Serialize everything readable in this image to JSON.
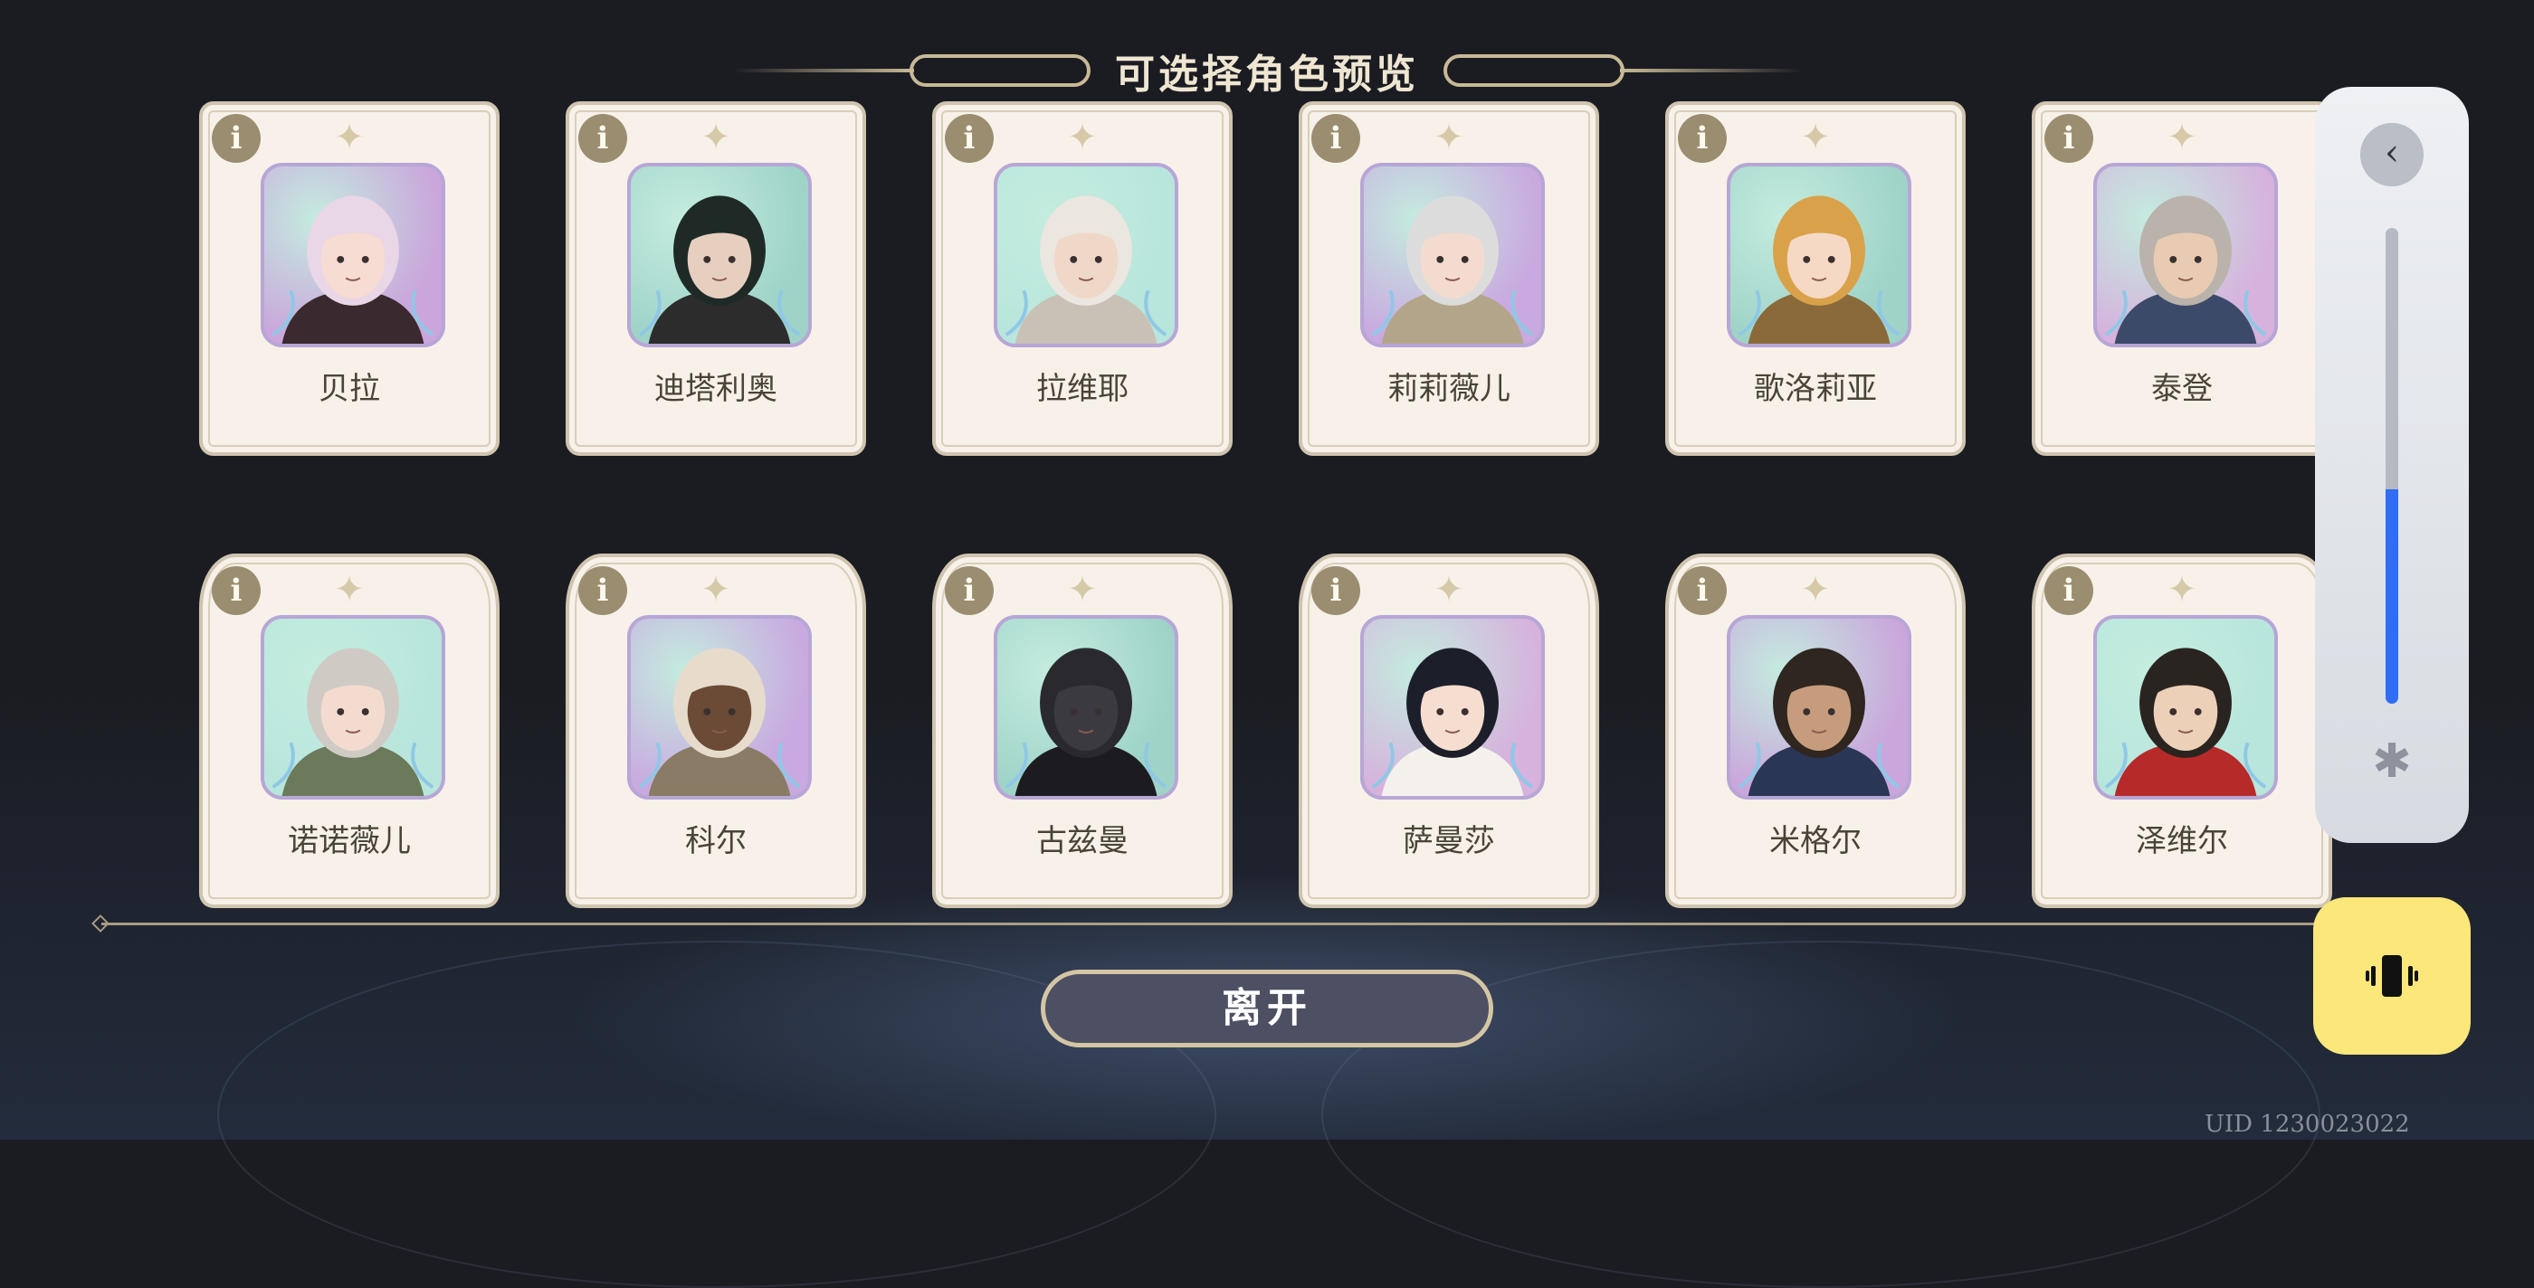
{
  "title": "可选择角色预览",
  "characters": [
    {
      "name": "贝拉",
      "info": "i",
      "hair": "#e9d6e6",
      "skin": "#f6dcd2",
      "accent": "#3a2a2f",
      "bg": "#caa6dc",
      "frame": "square"
    },
    {
      "name": "迪塔利奥",
      "info": "i",
      "hair": "#1f2a26",
      "skin": "#e6cfbf",
      "accent": "#2c2c2c",
      "bg": "#9fd3c8",
      "frame": "square"
    },
    {
      "name": "拉维耶",
      "info": "i",
      "hair": "#ece6e0",
      "skin": "#f0d8c8",
      "accent": "#c9c0b6",
      "bg": "#b8e6dc",
      "frame": "square"
    },
    {
      "name": "莉莉薇儿",
      "info": "i",
      "hair": "#dcdcdc",
      "skin": "#f3dccf",
      "accent": "#b3a58a",
      "bg": "#c9a9e0",
      "frame": "square"
    },
    {
      "name": "歌洛莉亚",
      "info": "i",
      "hair": "#d9a24a",
      "skin": "#f5d9c4",
      "accent": "#8a6a3a",
      "bg": "#9fd3c8",
      "frame": "square"
    },
    {
      "name": "泰登",
      "info": "i",
      "hair": "#b9b3ab",
      "skin": "#e8cbb2",
      "accent": "#3c4a6a",
      "bg": "#d6b2dd",
      "frame": "square"
    },
    {
      "name": "诺诺薇儿",
      "info": "i",
      "hair": "#cfcbc4",
      "skin": "#f3dccf",
      "accent": "#6b7a5a",
      "bg": "#b8e6dc",
      "frame": "arched"
    },
    {
      "name": "科尔",
      "info": "i",
      "hair": "#e7dccb",
      "skin": "#6b4a36",
      "accent": "#8a7b65",
      "bg": "#c9a9e0",
      "frame": "arched"
    },
    {
      "name": "古兹曼",
      "info": "i",
      "hair": "#2a2a2e",
      "skin": "#3a3a40",
      "accent": "#1c1c20",
      "bg": "#9fd3c8",
      "frame": "arched"
    },
    {
      "name": "萨曼莎",
      "info": "i",
      "hair": "#1c1f2a",
      "skin": "#f5ddd0",
      "accent": "#f4f1ec",
      "bg": "#d6b2dd",
      "frame": "arched"
    },
    {
      "name": "米格尔",
      "info": "i",
      "hair": "#2e261f",
      "skin": "#c69c7c",
      "accent": "#2a3656",
      "bg": "#caa6dc",
      "frame": "arched"
    },
    {
      "name": "泽维尔",
      "info": "i",
      "hair": "#2a2420",
      "skin": "#edd0b8",
      "accent": "#b62a2a",
      "bg": "#b8e6dc",
      "frame": "arched"
    }
  ],
  "leave_label": "离开",
  "uid": "UID 1230023022",
  "volume_panel": {
    "back_icon": "chevron-left-icon",
    "back_glyph": "‹",
    "level": 0.45,
    "bluetooth_icon": "bluetooth-icon",
    "bluetooth_glyph": "✱",
    "vibrate_icon": "vibrate-icon"
  },
  "colors": {
    "card_bg": "#f7f1ea",
    "gold": "#c8b996",
    "leave_bg": "#4d5063",
    "volume_fill": "#2f6df5",
    "vibrate_bg": "#fce77a"
  }
}
